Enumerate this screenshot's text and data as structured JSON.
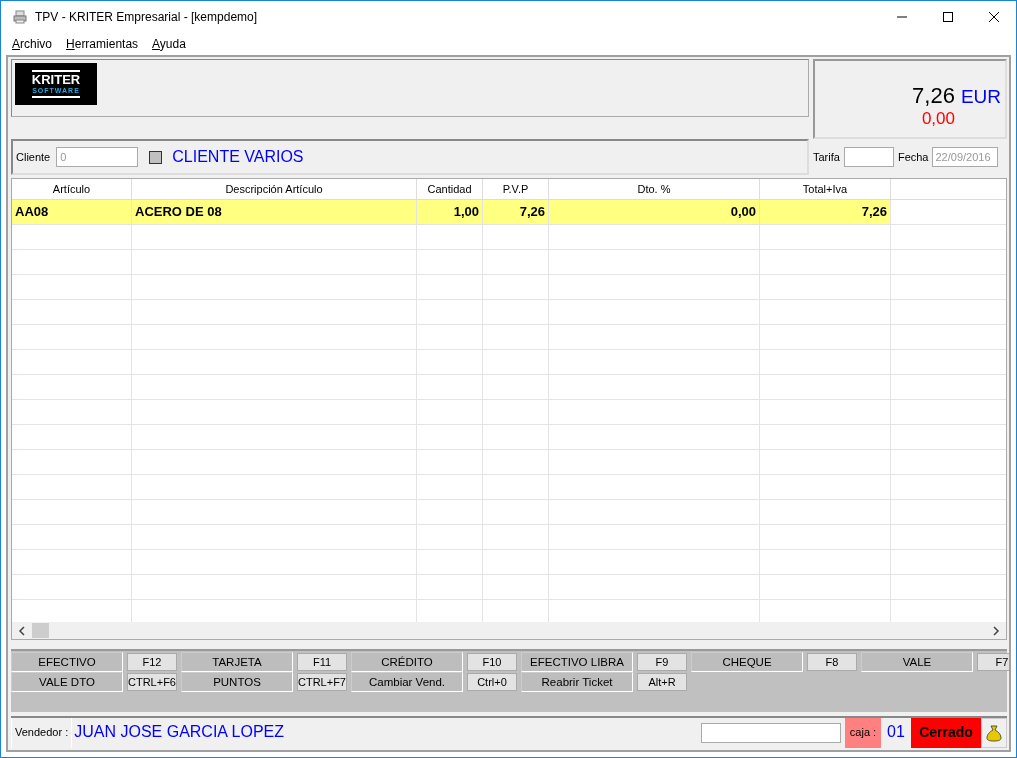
{
  "window": {
    "title": "TPV - KRITER Empresarial -  [kempdemo]"
  },
  "menu": [
    {
      "label": "Archivo"
    },
    {
      "label": "Herramientas"
    },
    {
      "label": "Ayuda"
    }
  ],
  "logo": {
    "text": "KRITER",
    "subtext": "SOFTWARE"
  },
  "totals": {
    "amount": "7,26",
    "currency": "EUR",
    "pending": "0,00"
  },
  "client": {
    "label": "Cliente",
    "value": "0",
    "checked": false,
    "name": "CLIENTE VARIOS"
  },
  "tarifa": {
    "label": "Tarifa"
  },
  "fecha": {
    "label": "Fecha",
    "value": "22/09/2016",
    "disabled": true
  },
  "table": {
    "columns": [
      "Artículo",
      "Descripción Artículo",
      "Cantidad",
      "P.V.P",
      "Dto. %",
      "Total+Iva"
    ],
    "rows": [
      {
        "cells": [
          "AA08",
          "ACERO DE 08",
          "1,00",
          "7,26",
          "0,00",
          "7,26"
        ],
        "selected": true
      }
    ]
  },
  "actions": [
    [
      {
        "label": "EFECTIVO",
        "key": "F12"
      },
      {
        "label": "TARJETA",
        "key": "F11"
      },
      {
        "label": "CRÉDITO",
        "key": "F10"
      },
      {
        "label": "EFECTIVO LIBRA",
        "key": "F9"
      },
      {
        "label": "CHEQUE",
        "key": "F8"
      },
      {
        "label": "VALE",
        "key": "F7"
      }
    ],
    [
      {
        "label": "VALE DTO",
        "key": "CTRL+F6"
      },
      {
        "label": "PUNTOS",
        "key": "CTRL+F7"
      },
      {
        "label": "Cambiar Vend.",
        "key": "Ctrl+0"
      },
      {
        "label": "Reabrir Ticket",
        "key": "Alt+R"
      }
    ]
  ],
  "status_bar": {
    "vendedor_label": "Vendedor :",
    "vendedor": "JUAN JOSE GARCIA LOPEZ",
    "caja_label": "caja :",
    "caja": "01",
    "state": "Cerrado",
    "closed": true
  }
}
